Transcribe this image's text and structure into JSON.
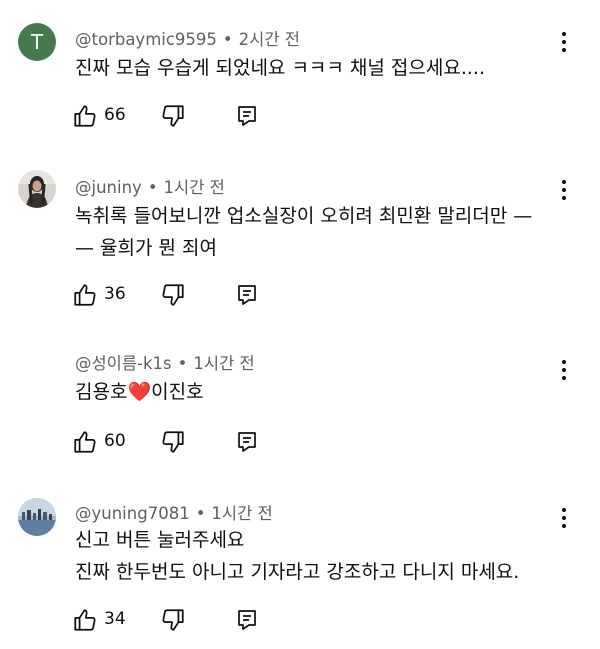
{
  "comments": [
    {
      "avatar_letter": "T",
      "avatar_color": "#457a4d",
      "author": "@torbaymic9595",
      "separator": "•",
      "time": "2시간 전",
      "lines": [
        "진짜 모습 우습게 되었네요 ㅋㅋㅋ 채널 접으세요...."
      ],
      "likes": "66"
    },
    {
      "avatar_type": "photo-person",
      "author": "@juniny",
      "separator": "•",
      "time": "1시간 전",
      "lines": [
        "녹취록 들어보니깐 업소실장이 오히려 최민환 말리더만 —",
        "— 율희가 뭔  죄여"
      ],
      "likes": "36"
    },
    {
      "avatar_type": "none",
      "author": "@성이름-k1s",
      "separator": "•",
      "time": "1시간 전",
      "text_before": "김용호",
      "heart": "❤️",
      "text_after": "이진호",
      "likes": "60"
    },
    {
      "avatar_type": "photo-landscape",
      "author": "@yuning7081",
      "separator": "•",
      "time": "1시간 전",
      "lines": [
        "신고 버튼 눌러주세요",
        "진짜 한두번도 아니고 기자라고 강조하고 다니지 마세요."
      ],
      "likes": "34"
    }
  ],
  "icons": {
    "like": "thumbs-up-icon",
    "dislike": "thumbs-down-icon",
    "reply": "reply-icon",
    "more": "more-vertical-icon"
  }
}
